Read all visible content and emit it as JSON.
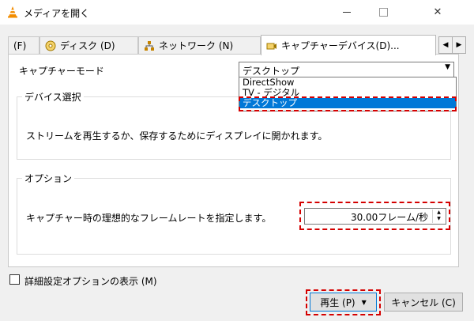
{
  "window": {
    "title": "メディアを開く",
    "close_glyph": "✕"
  },
  "tabs": [
    {
      "label": "(F)",
      "icon": "file-icon"
    },
    {
      "label": "ディスク (D)",
      "icon": "disc-icon"
    },
    {
      "label": "ネットワーク (N)",
      "icon": "network-icon"
    },
    {
      "label": "キャプチャーデバイス(D)...",
      "icon": "capture-icon"
    }
  ],
  "tab_scroll": {
    "left": "◀",
    "right": "▶"
  },
  "capture_mode": {
    "label": "キャプチャーモード",
    "selected": "デスクトップ",
    "arrow": "▼",
    "options": [
      "DirectShow",
      "TV - デジタル",
      "デスクトップ"
    ]
  },
  "device_group": {
    "legend": "デバイス選択",
    "text": "ストリームを再生するか、保存するためにディスプレイに開かれます。"
  },
  "options_group": {
    "legend": "オプション",
    "text": "キャプチャー時の理想的なフレームレートを指定します。",
    "framerate_value": "30.00フレーム/秒",
    "up": "▲",
    "down": "▼"
  },
  "advanced": {
    "label": "詳細設定オプションの表示 (M)",
    "checked": false
  },
  "buttons": {
    "play": "再生 (P)",
    "play_arrow": "▼",
    "cancel": "キャンセル (C)"
  },
  "colors": {
    "highlight": "#0078d7",
    "annotation": "#d40000",
    "vlc_orange": "#f28c00"
  }
}
